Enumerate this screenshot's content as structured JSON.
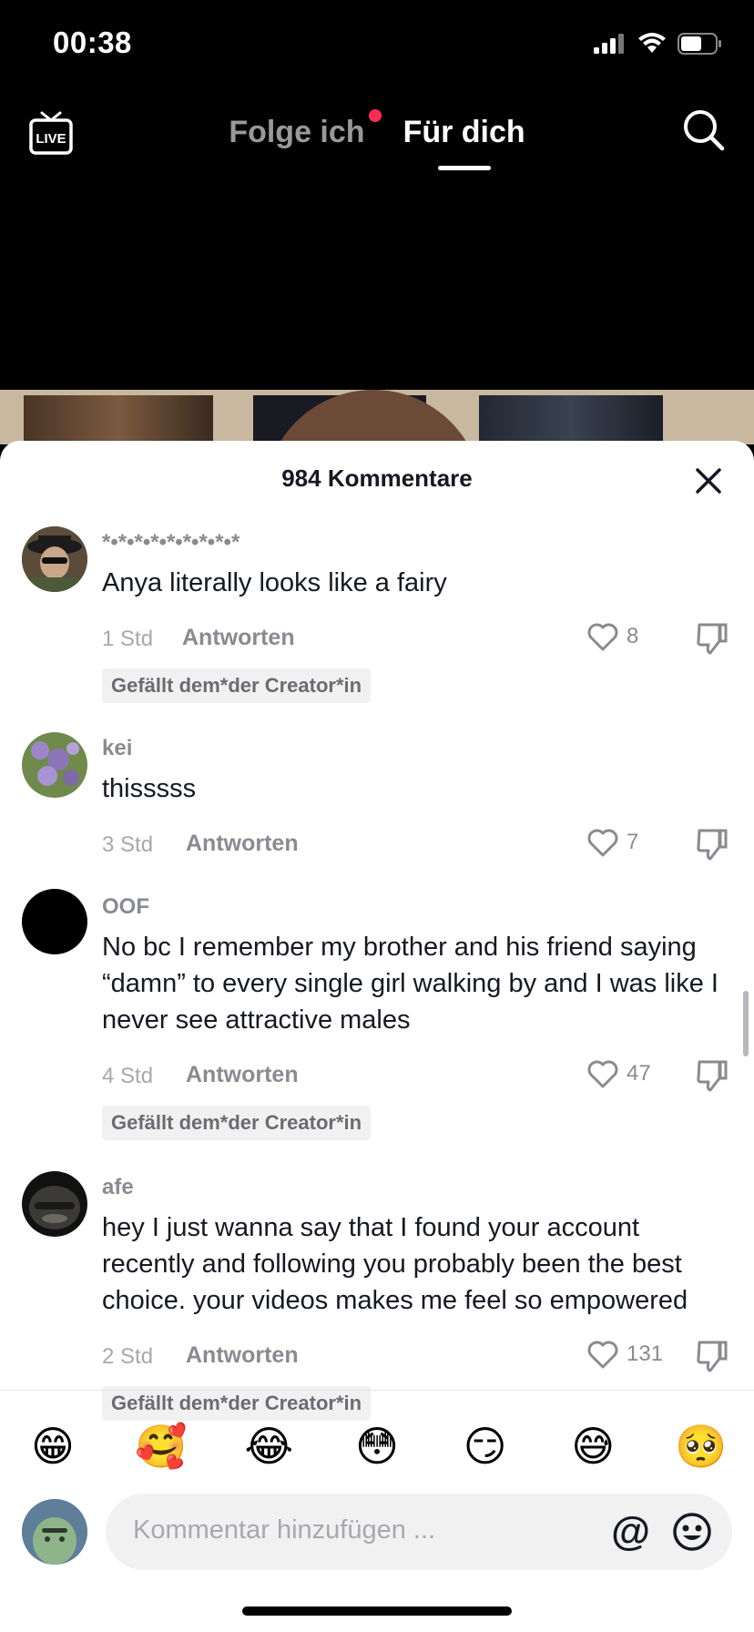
{
  "status_bar": {
    "time": "00:38"
  },
  "top_nav": {
    "live_label": "LIVE",
    "tabs": [
      {
        "label": "Folge ich",
        "active": false,
        "has_dot": true
      },
      {
        "label": "Für dich",
        "active": true
      }
    ]
  },
  "sheet": {
    "title": "984 Kommentare",
    "reply_label": "Antworten",
    "comments": [
      {
        "user": "*•*•*•*•*•*•*•*•*",
        "text": "Anya literally looks like a fairy",
        "time": "1 Std",
        "likes": "8",
        "badge": "Gefällt dem*der Creator*in"
      },
      {
        "user": "kei",
        "text": "thisssss",
        "time": "3 Std",
        "likes": "7",
        "badge": ""
      },
      {
        "user": "OOF",
        "text": "No bc I remember my brother and his friend saying “damn” to every single girl walking by and I was like I never see attractive males",
        "time": "4 Std",
        "likes": "47",
        "badge": "Gefällt dem*der Creator*in"
      },
      {
        "user": "afe",
        "text": "hey I just wanna say that I found your account recently and following you probably been the best choice. your videos makes me feel so empowered",
        "time": "2 Std",
        "likes": "131",
        "badge": "Gefällt dem*der Creator*in"
      }
    ]
  },
  "emoji_bar": [
    "😁",
    "🥰",
    "😂",
    "😳",
    "😏",
    "😅",
    "🥺"
  ],
  "input": {
    "placeholder": "Kommentar hinzufügen ...",
    "at_symbol": "@"
  },
  "icons": {
    "live": "live-icon",
    "search": "search-icon",
    "close": "close-icon",
    "like": "heart-icon",
    "dislike": "thumbs-down-icon",
    "emoji": "smiley-icon"
  },
  "colors": {
    "accent": "#fe2c55",
    "text_primary": "#161823",
    "text_secondary": "#8a8b91"
  }
}
